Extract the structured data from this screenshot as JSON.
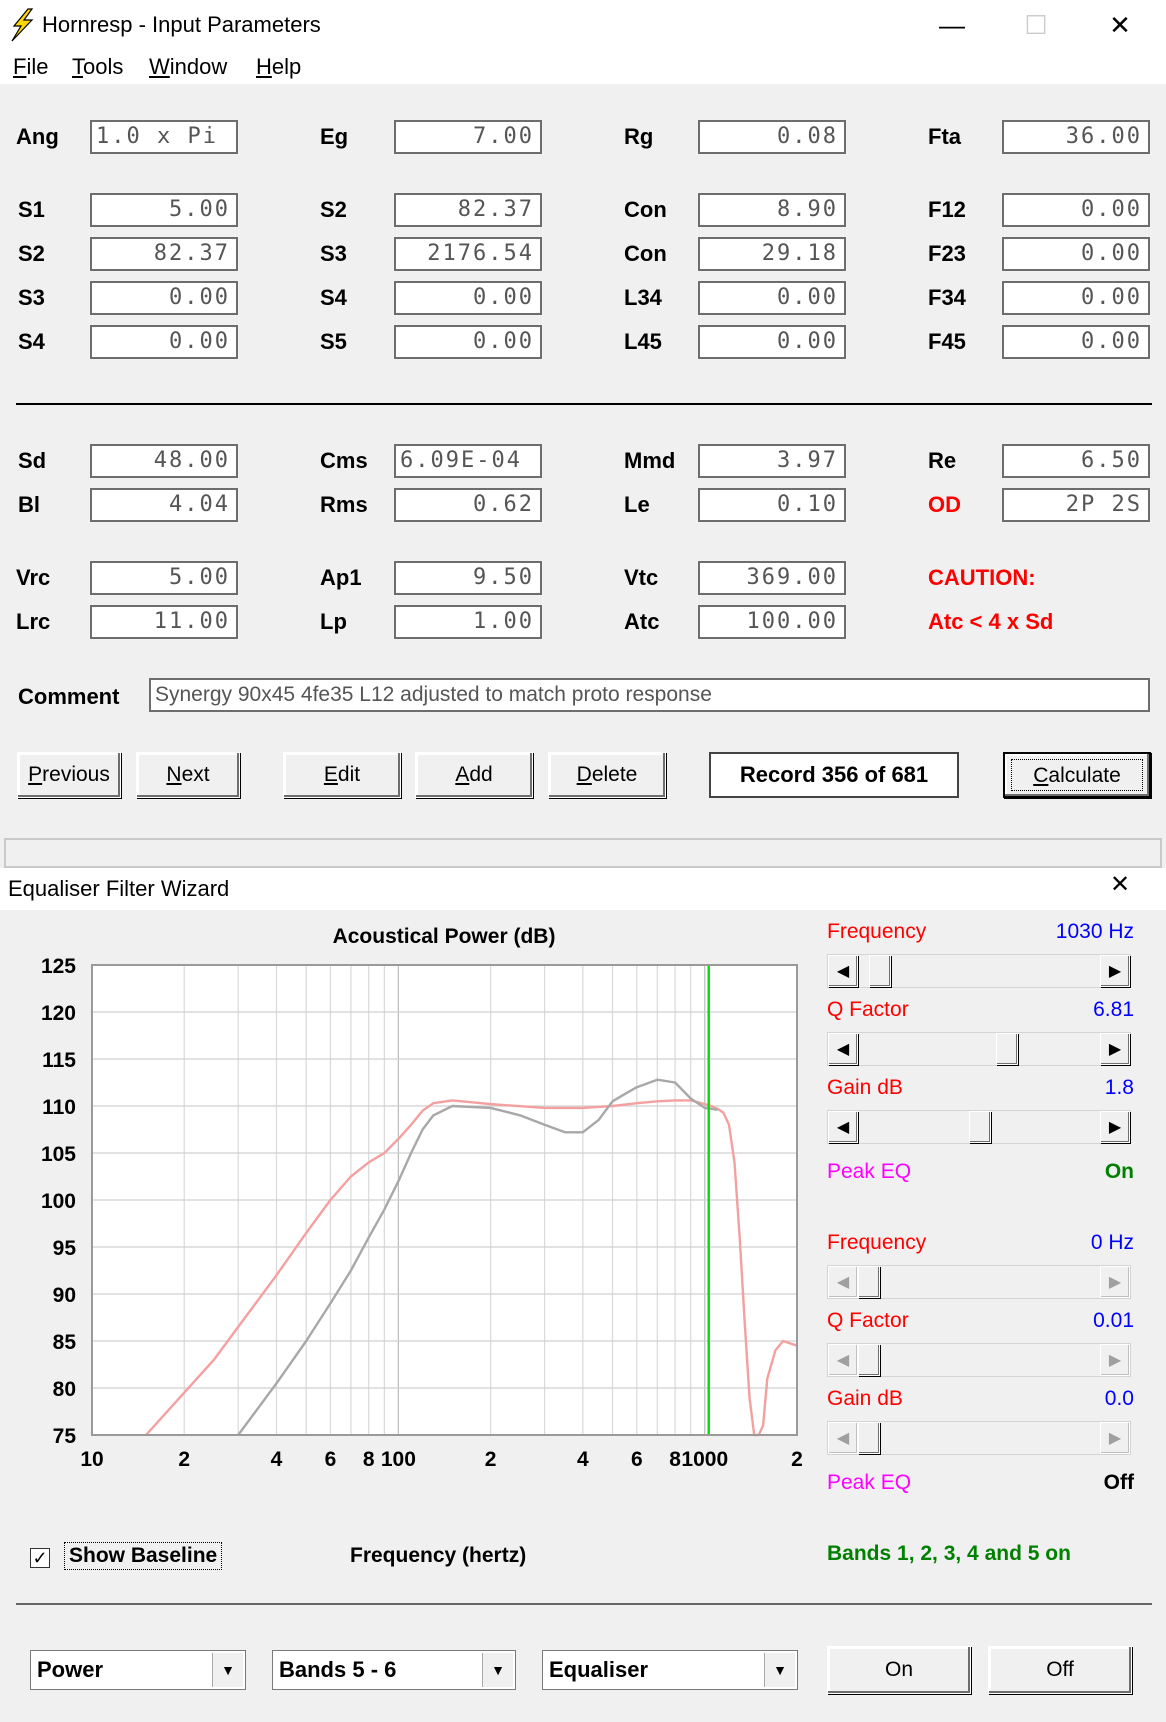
{
  "window1": {
    "title": "Hornresp - Input Parameters",
    "controls": {
      "minimize": "—",
      "maximize": "☐",
      "close": "✕"
    },
    "menu": [
      {
        "key": "F",
        "rest": "ile"
      },
      {
        "key": "T",
        "rest": "ools"
      },
      {
        "key": "W",
        "rest": "indow"
      },
      {
        "key": "H",
        "rest": "elp"
      }
    ],
    "params": {
      "ang": {
        "label": "Ang",
        "value": "1.0 x Pi"
      },
      "eg": {
        "label": "Eg",
        "value": "7.00"
      },
      "rg": {
        "label": "Rg",
        "value": "0.08"
      },
      "fta": {
        "label": "Fta",
        "value": "36.00"
      },
      "s1": {
        "label": "S1",
        "value": "5.00"
      },
      "s2a": {
        "label": "S2",
        "value": "82.37"
      },
      "con1": {
        "label": "Con",
        "value": "8.90"
      },
      "f12": {
        "label": "F12",
        "value": "0.00"
      },
      "s2b": {
        "label": "S2",
        "value": "82.37"
      },
      "s3a": {
        "label": "S3",
        "value": "2176.54"
      },
      "con2": {
        "label": "Con",
        "value": "29.18"
      },
      "f23": {
        "label": "F23",
        "value": "0.00"
      },
      "s3b": {
        "label": "S3",
        "value": "0.00"
      },
      "s4a": {
        "label": "S4",
        "value": "0.00"
      },
      "l34": {
        "label": "L34",
        "value": "0.00"
      },
      "f34": {
        "label": "F34",
        "value": "0.00"
      },
      "s4b": {
        "label": "S4",
        "value": "0.00"
      },
      "s5": {
        "label": "S5",
        "value": "0.00"
      },
      "l45": {
        "label": "L45",
        "value": "0.00"
      },
      "f45": {
        "label": "F45",
        "value": "0.00"
      },
      "sd": {
        "label": "Sd",
        "value": "48.00"
      },
      "cms": {
        "label": "Cms",
        "value": "6.09E-04"
      },
      "mmd": {
        "label": "Mmd",
        "value": "3.97"
      },
      "re": {
        "label": "Re",
        "value": "6.50"
      },
      "bl": {
        "label": "Bl",
        "value": "4.04"
      },
      "rms": {
        "label": "Rms",
        "value": "0.62"
      },
      "le": {
        "label": "Le",
        "value": "0.10"
      },
      "od": {
        "label": "OD",
        "value": "2P 2S"
      },
      "vrc": {
        "label": "Vrc",
        "value": "5.00"
      },
      "ap1": {
        "label": "Ap1",
        "value": "9.50"
      },
      "vtc": {
        "label": "Vtc",
        "value": "369.00"
      },
      "lrc": {
        "label": "Lrc",
        "value": "11.00"
      },
      "lp": {
        "label": "Lp",
        "value": "1.00"
      },
      "atc": {
        "label": "Atc",
        "value": "100.00"
      }
    },
    "caution": {
      "title": "CAUTION:",
      "message": "Atc < 4 x Sd"
    },
    "comment": {
      "label": "Comment",
      "value": "Synergy 90x45 4fe35  L12 adjusted to match proto response"
    },
    "buttons": {
      "previous": {
        "key": "P",
        "rest": "revious"
      },
      "next": {
        "key": "N",
        "rest": "ext"
      },
      "edit": {
        "key": "E",
        "rest": "dit"
      },
      "add": {
        "key": "A",
        "rest": "dd"
      },
      "delete": {
        "key": "D",
        "rest": "elete"
      },
      "calculate": {
        "key": "C",
        "rest": "alculate"
      }
    },
    "record": "Record 356 of 681"
  },
  "window2": {
    "title": "Equaliser Filter Wizard",
    "close": "✕",
    "eq1": {
      "frequency": {
        "label": "Frequency",
        "value": "1030 Hz",
        "position": 0.05
      },
      "q_factor": {
        "label": "Q Factor",
        "value": "6.81",
        "position": 0.62
      },
      "gain": {
        "label": "Gain  dB",
        "value": "1.8",
        "position": 0.5
      },
      "peak_eq": {
        "label": "Peak EQ",
        "state": "On"
      }
    },
    "eq2": {
      "frequency": {
        "label": "Frequency",
        "value": "0 Hz",
        "position": 0.0
      },
      "q_factor": {
        "label": "Q Factor",
        "value": "0.01",
        "position": 0.0
      },
      "gain": {
        "label": "Gain  dB",
        "value": "0.0",
        "position": 0.0
      },
      "peak_eq": {
        "label": "Peak EQ",
        "state": "Off"
      }
    },
    "show_baseline": {
      "label": "Show Baseline",
      "checked": "✓"
    },
    "bands_status": "Bands 1, 2, 3, 4 and 5 on",
    "combos": {
      "mode": {
        "value": "Power",
        "arrow": "▼"
      },
      "bands": {
        "value": "Bands 5 - 6",
        "arrow": "▼"
      },
      "type": {
        "value": "Equaliser",
        "arrow": "▼"
      }
    },
    "on_button": "On",
    "off_button": "Off",
    "colors": {
      "label_red": "#ff0000",
      "label_magenta": "#ff00ff",
      "value_blue": "#0000ff",
      "state_green": "#008000",
      "equalised_curve": "#f4a0a0",
      "baseline_curve": "#a8a8a8",
      "marker": "#00dd00"
    }
  },
  "chart_data": {
    "type": "line",
    "title": "Acoustical Power (dB)",
    "xlabel": "Frequency (hertz)",
    "ylabel": "",
    "x_scale": "log",
    "xlim": [
      10,
      2000
    ],
    "ylim": [
      75,
      125
    ],
    "yticks": [
      125,
      120,
      115,
      110,
      105,
      100,
      95,
      90,
      85,
      80,
      75
    ],
    "xtick_labels": [
      {
        "x": 10,
        "label": "10"
      },
      {
        "x": 20,
        "label": "2"
      },
      {
        "x": 40,
        "label": "4"
      },
      {
        "x": 60,
        "label": "6"
      },
      {
        "x": 80,
        "label": "8"
      },
      {
        "x": 100,
        "label": "100"
      },
      {
        "x": 200,
        "label": "2"
      },
      {
        "x": 400,
        "label": "4"
      },
      {
        "x": 600,
        "label": "6"
      },
      {
        "x": 800,
        "label": "8"
      },
      {
        "x": 1000,
        "label": "1000"
      },
      {
        "x": 2000,
        "label": "2"
      }
    ],
    "grid": true,
    "marker_x": 1030,
    "series": [
      {
        "color": "#f4a0a0",
        "x": [
          15,
          20,
          25,
          30,
          40,
          50,
          60,
          70,
          80,
          90,
          100,
          110,
          120,
          130,
          150,
          200,
          300,
          400,
          500,
          600,
          700,
          800,
          900,
          1000,
          1050,
          1100,
          1150,
          1200,
          1250,
          1300,
          1350,
          1400,
          1450,
          1500,
          1550,
          1600,
          1700,
          1800,
          2000
        ],
        "y": [
          75,
          79.5,
          83,
          86.5,
          92,
          96.5,
          100,
          102.5,
          104,
          105,
          106.5,
          108,
          109.5,
          110.3,
          110.6,
          110.2,
          109.8,
          109.8,
          110.0,
          110.3,
          110.5,
          110.6,
          110.6,
          110.2,
          110.0,
          109.7,
          109.3,
          108,
          104,
          96,
          87,
          79,
          75,
          75,
          76,
          81,
          84,
          85,
          84.5
        ]
      },
      {
        "color": "#a8a8a8",
        "x": [
          30,
          40,
          50,
          60,
          70,
          80,
          90,
          100,
          110,
          120,
          130,
          150,
          200,
          250,
          300,
          350,
          400,
          450,
          500,
          550,
          600,
          700,
          800,
          900,
          1000,
          1050,
          1100
        ],
        "y": [
          75,
          80.5,
          85,
          89,
          92.5,
          96,
          99,
          102,
          105,
          107.5,
          109,
          110.0,
          109.8,
          109.0,
          108.0,
          107.2,
          107.2,
          108.5,
          110.5,
          111.3,
          112.0,
          112.8,
          112.5,
          110.8,
          109.8,
          109.7,
          109.6
        ]
      }
    ]
  }
}
